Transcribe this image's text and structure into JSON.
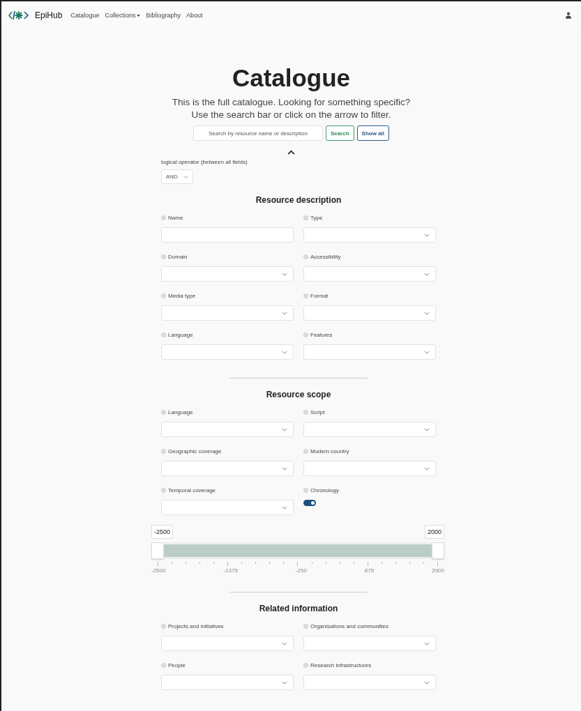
{
  "navbar": {
    "brand": "EpiHub",
    "links": [
      {
        "label": "Catalogue",
        "dropdown": false
      },
      {
        "label": "Collections",
        "dropdown": true
      },
      {
        "label": "Bibliography",
        "dropdown": false
      },
      {
        "label": "About",
        "dropdown": false
      }
    ]
  },
  "header": {
    "title": "Catalogue",
    "subtitle_lines": [
      "This is the full catalogue. Looking for something specific?",
      "Use the search bar or click on the arrow to filter."
    ]
  },
  "search": {
    "placeholder": "Search by resource name or description",
    "search_button": "Search",
    "show_all_button": "Show all"
  },
  "filters_expanded": true,
  "logical_operator": {
    "label": "logical operator (between all fields)",
    "value": "AND"
  },
  "sections": [
    {
      "title": "Resource description",
      "fields": [
        {
          "label": "Name",
          "kind": "text"
        },
        {
          "label": "Type",
          "kind": "select"
        },
        {
          "label": "Domain",
          "kind": "select"
        },
        {
          "label": "Accessibility",
          "kind": "select"
        },
        {
          "label": "Media type",
          "kind": "select"
        },
        {
          "label": "Format",
          "kind": "select"
        },
        {
          "label": "Language",
          "kind": "select"
        },
        {
          "label": "Features",
          "kind": "select"
        }
      ]
    },
    {
      "title": "Resource scope",
      "fields": [
        {
          "label": "Language",
          "kind": "select"
        },
        {
          "label": "Script",
          "kind": "select"
        },
        {
          "label": "Geographic coverage",
          "kind": "select"
        },
        {
          "label": "Modern country",
          "kind": "select"
        },
        {
          "label": "Temporal coverage",
          "kind": "select"
        },
        {
          "label": "Chronology",
          "kind": "toggle",
          "on": true
        }
      ],
      "range": {
        "min_label": "-2500",
        "max_label": "2000",
        "handles": [
          {
            "level": 0
          },
          {
            "level": 1
          }
        ],
        "tick_labels": [
          "-2500",
          "-1375",
          "-250",
          "875",
          "2000"
        ]
      }
    },
    {
      "title": "Related information",
      "fields": [
        {
          "label": "Projects and initiatives",
          "kind": "select"
        },
        {
          "label": "Organisations and communities",
          "kind": "select"
        },
        {
          "label": "People",
          "kind": "select"
        },
        {
          "label": "Research infrastructures",
          "kind": "select"
        }
      ]
    }
  ]
}
